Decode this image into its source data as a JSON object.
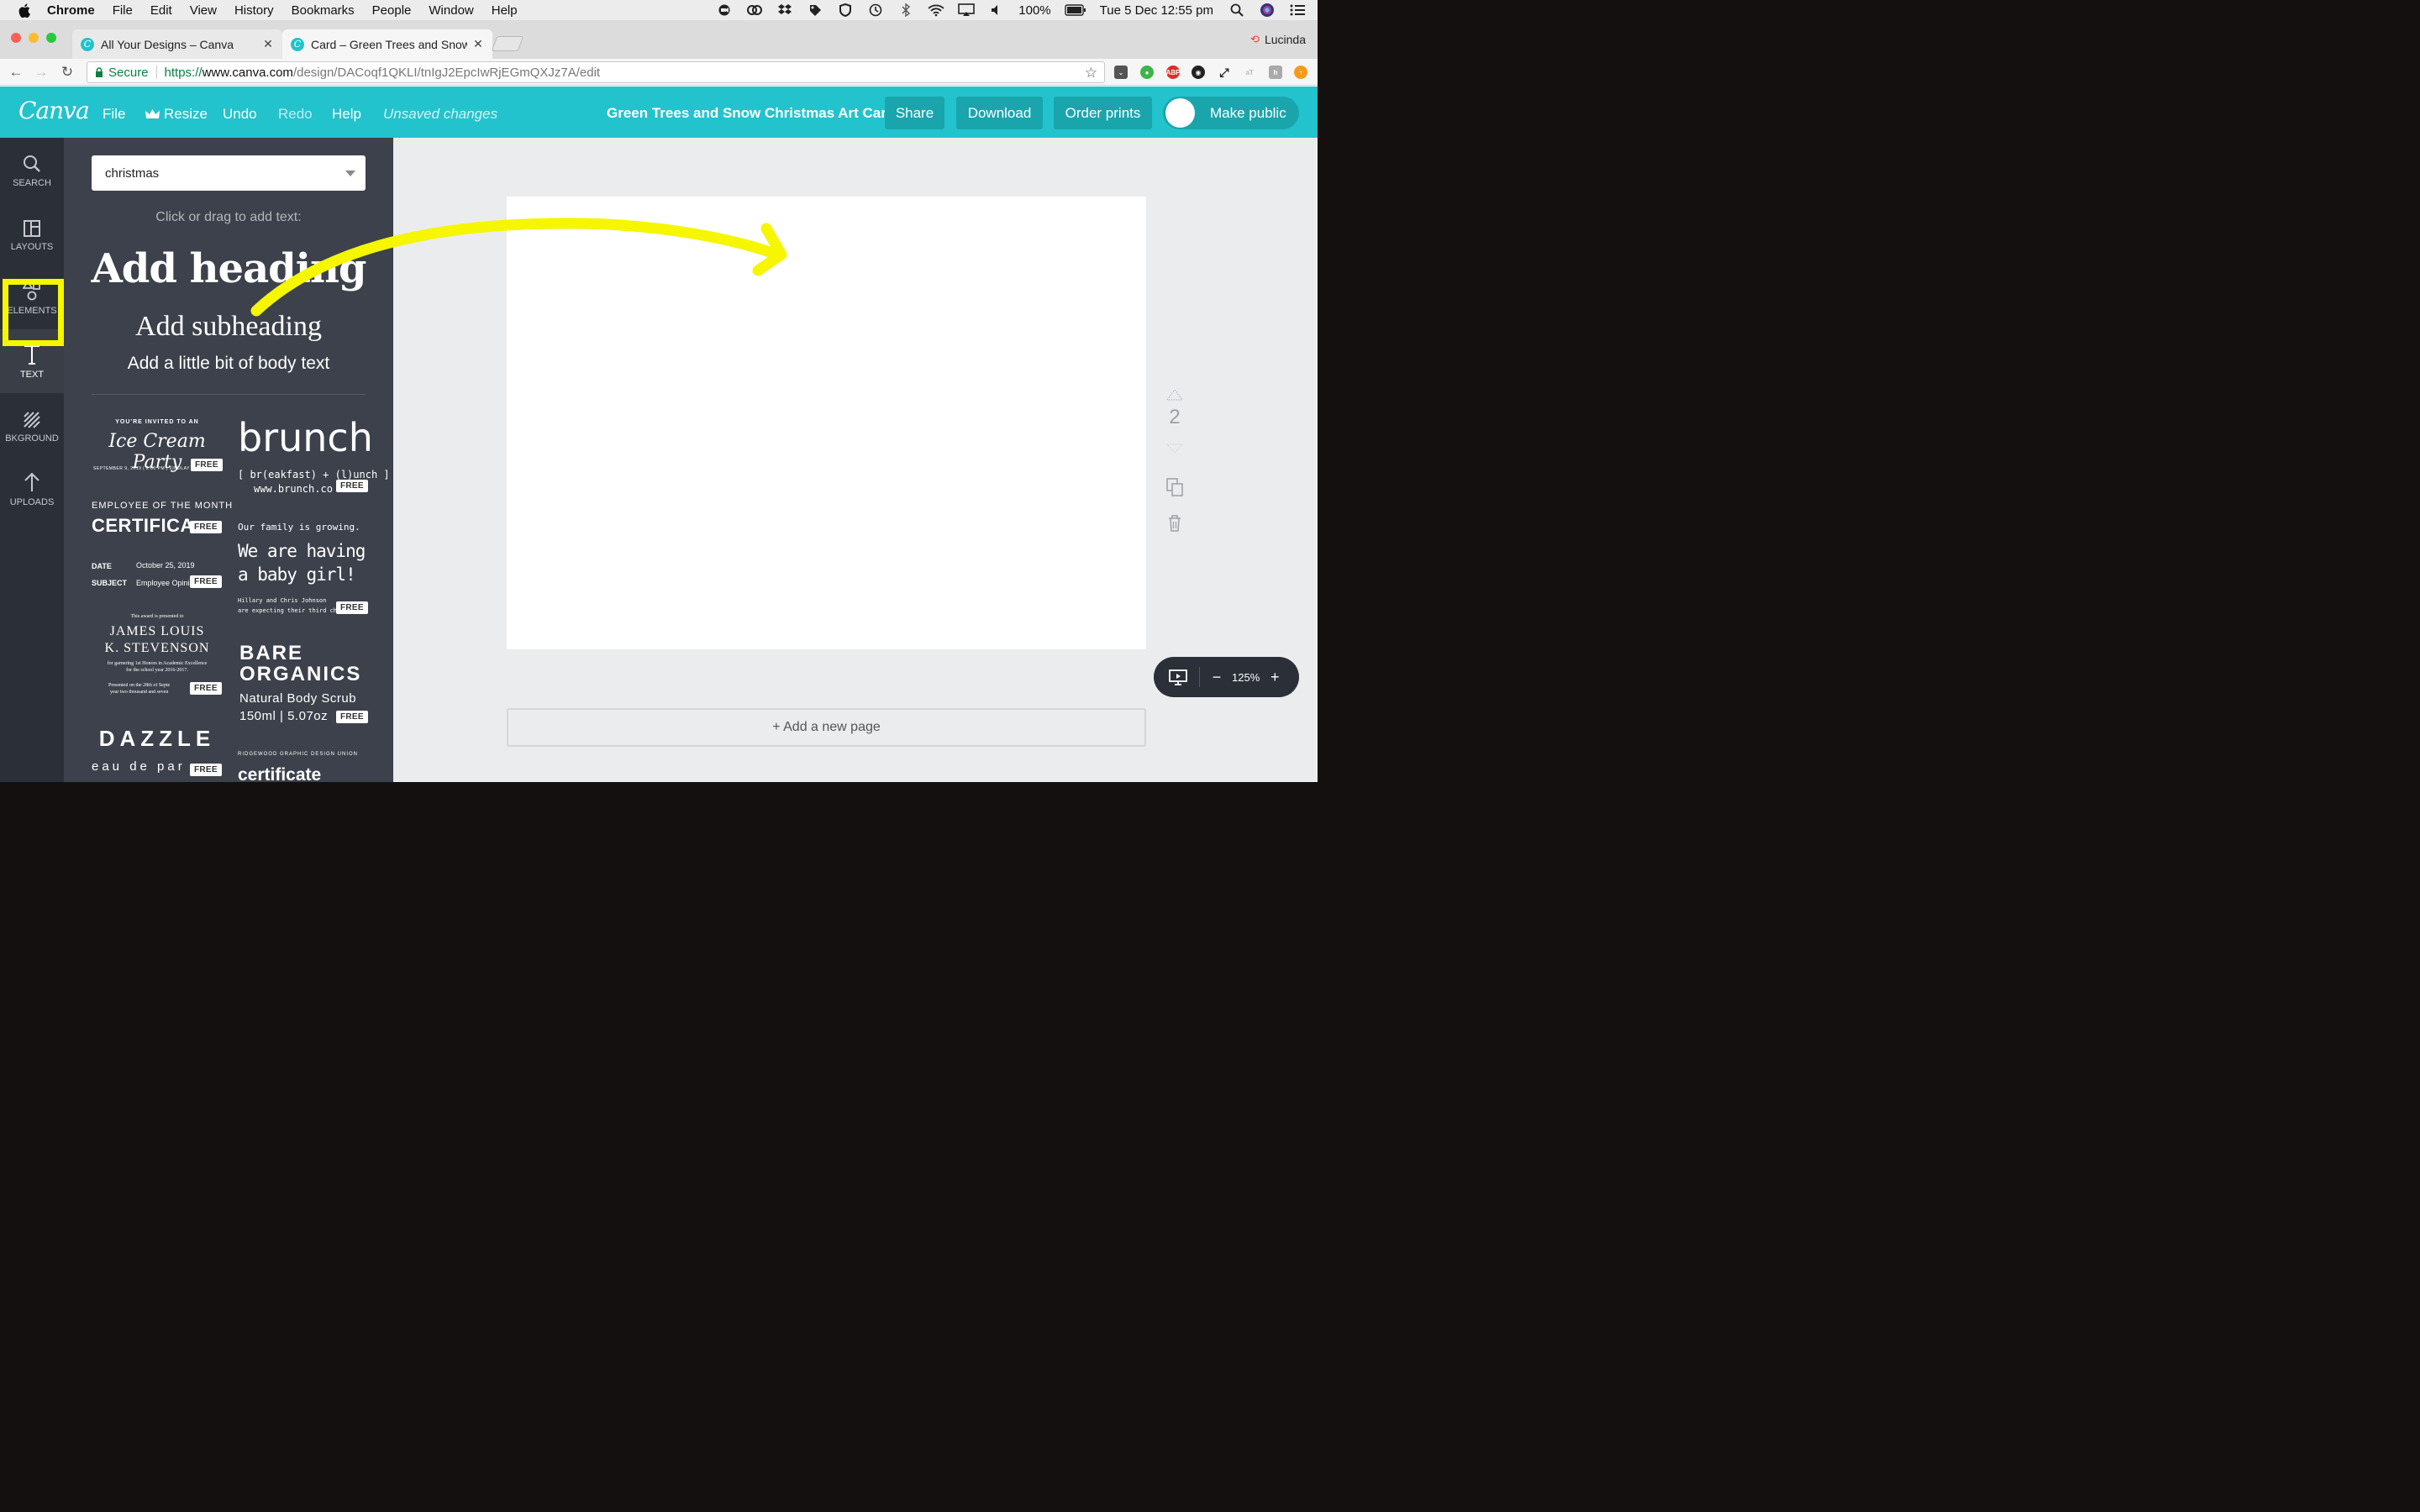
{
  "menubar": {
    "app": "Chrome",
    "items": [
      "File",
      "Edit",
      "View",
      "History",
      "Bookmarks",
      "People",
      "Window",
      "Help"
    ],
    "battery": "100%",
    "clock": "Tue 5 Dec  12:55 pm"
  },
  "browser": {
    "tabs": [
      {
        "title": "All Your Designs – Canva"
      },
      {
        "title": "Card – Green Trees and Snow C"
      }
    ],
    "profile": "Lucinda",
    "secure_label": "Secure",
    "url_proto": "https://",
    "url_host": "www.canva.com",
    "url_path": "/design/DACoqf1QKLI/tnIgJ2EpcIwRjEGmQXJz7A/edit",
    "ext_abp": "ABP"
  },
  "canva": {
    "logo": "Canva",
    "nav": {
      "file": "File",
      "resize": "Resize",
      "undo": "Undo",
      "redo": "Redo",
      "help": "Help",
      "unsaved": "Unsaved changes"
    },
    "doc_title": "Green Trees and Snow Christmas Art Card",
    "buttons": {
      "share": "Share",
      "download": "Download",
      "order_prints": "Order prints",
      "make_public": "Make public"
    },
    "rail": [
      {
        "label": "SEARCH"
      },
      {
        "label": "LAYOUTS"
      },
      {
        "label": "ELEMENTS"
      },
      {
        "label": "TEXT"
      },
      {
        "label": "BKGROUND"
      },
      {
        "label": "UPLOADS"
      }
    ],
    "panel": {
      "search_value": "christmas",
      "hint": "Click or drag to add text:",
      "heading": "Add heading",
      "subheading": "Add subheading",
      "body": "Add a little bit of body text",
      "free": "FREE",
      "templates": {
        "icecream_top": "YOU'RE INVITED TO AN",
        "icecream_title": "Ice Cream Party",
        "icecream_date": "SEPTEMBER 9, 2019 | 2:00 PM | FINDLAY",
        "brunch_title": "brunch",
        "brunch_sub": "[ br(eakfast) + (l)unch ]",
        "brunch_url": "www.brunch.co",
        "employee_top": "EMPLOYEE OF THE MONTH",
        "employee_title": "CERTIFICA",
        "date_label": "DATE",
        "date_value": "October 25, 2019",
        "subject_label": "SUBJECT",
        "subject_value": "Employee Opini",
        "family_line": "Our family is growing.",
        "baby_line1": "We are having",
        "baby_line2": "a baby girl!",
        "baby_small1": "Hillary and Chris Johnson",
        "baby_small2": "are expecting their third chil",
        "award_top": "This award is presented to",
        "award_name1": "JAMES LOUIS",
        "award_name2": "K. STEVENSON",
        "award_small1": "for garnering 1st Honors in Academic Excellence",
        "award_small2": "for the school year 2016-2017.",
        "award_small3": "Presented on the 28th of Septe",
        "award_small4": "year two thousand and seven",
        "bare1": "BARE",
        "bare2": "ORGANICS",
        "bare3": "Natural Body Scrub",
        "bare4": "150ml | 5.07oz",
        "dazzle": "DAZZLE",
        "dazzle_sub": "eau de par",
        "ridgewood": "RIDGEWOOD GRAPHIC DESIGN UNION",
        "cert2": "certificate"
      }
    },
    "page_number": "2",
    "add_page": "+ Add a new page",
    "zoom": "125%"
  },
  "colors": {
    "canva_teal": "#22c3cc",
    "button_teal": "#1aa5ad",
    "highlight_yellow": "#f5f600",
    "rail_dark": "#2a2f38",
    "panel_dark": "#3c414b"
  }
}
